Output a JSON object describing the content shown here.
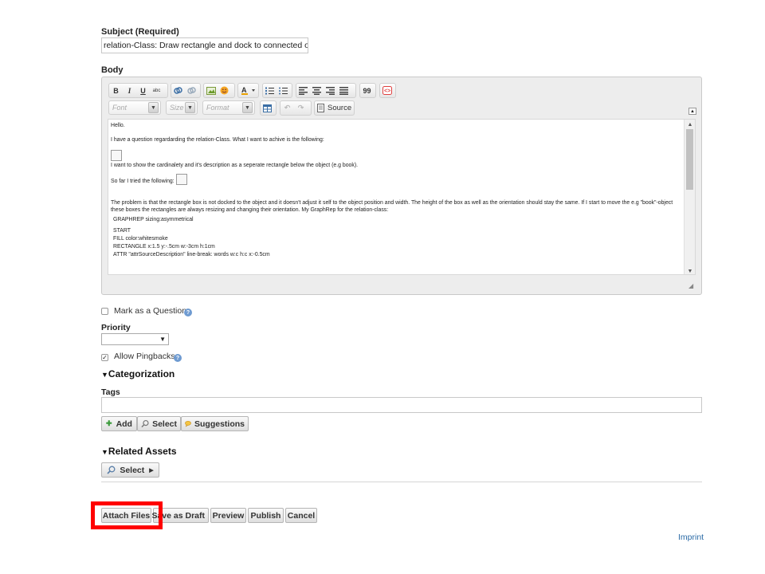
{
  "subject": {
    "label": "Subject (Required)",
    "value": "relation-Class: Draw rectangle and dock to connected object"
  },
  "body": {
    "label": "Body",
    "toolbar": {
      "font_placeholder": "Font",
      "size_placeholder": "Size",
      "format_placeholder": "Format",
      "source_label": "Source",
      "bold": "B",
      "italic": "I",
      "underline": "U",
      "strike": "abc",
      "quote": "99"
    },
    "content": {
      "p1": "Hello.",
      "p2": "I have a question regardarding the relation-Class. What I want to achive is the following:",
      "p3": "I want to show the cardinalety and it's description as a seperate rectangle below the object (e.g book).",
      "p4": "So far I tried the following:",
      "p5": "The problem is that the rectangle box is not docked to the object and it doesn't adjust it self to the object position and width. The height of the box as well as the orientation should stay the same. If I start to move the e.g \"book\"-object these boxes the rectangles are always resizing and changing their orientation. My GraphRep for the relation-class:",
      "code1": "GRAPHREP  sizing:asymmetrical",
      "code2": "START",
      "code3": "FILL color:whitesmoke",
      "code4": "RECTANGLE x:1.5 y:-.5cm w:-3cm h:1cm",
      "code5": "ATTR \"attrSourceDescription\" line-break: words w:c h:c x:-0.5cm"
    }
  },
  "mark_question": {
    "label": "Mark as a Question",
    "checked": false
  },
  "priority": {
    "label": "Priority",
    "value": ""
  },
  "pingbacks": {
    "label": "Allow Pingbacks",
    "checked": true
  },
  "categorization": {
    "title": "Categorization",
    "tags_label": "Tags",
    "add_label": "Add",
    "select_label": "Select",
    "suggestions_label": "Suggestions"
  },
  "related_assets": {
    "title": "Related Assets",
    "select_label": "Select"
  },
  "actions": {
    "attach": "Attach Files",
    "draft": "Save as Draft",
    "preview": "Preview",
    "publish": "Publish",
    "cancel": "Cancel"
  },
  "footer": {
    "imprint": "Imprint"
  },
  "colors": {
    "highlight": "#ff0000",
    "link": "#2a6aa6"
  }
}
